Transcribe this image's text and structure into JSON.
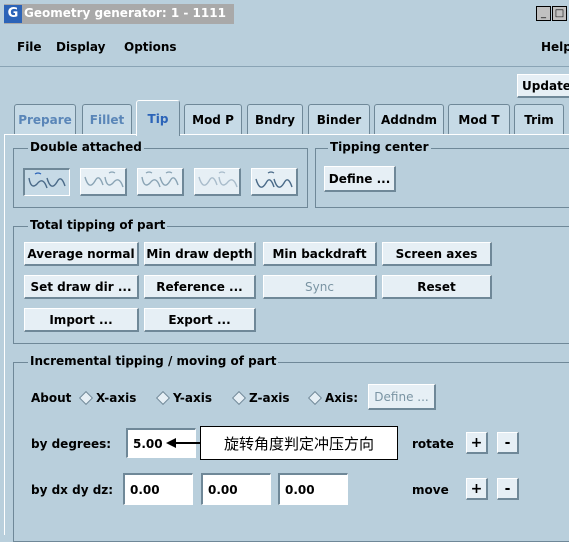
{
  "window": {
    "title": "Geometry generator: 1 - 1111",
    "app_icon": "G",
    "controls": [
      "_",
      "□",
      ""
    ]
  },
  "menu": {
    "file": "File",
    "display": "Display",
    "options": "Options",
    "help": "Help"
  },
  "toolbar": {
    "update": "Update"
  },
  "tabs": [
    {
      "label": "Prepare",
      "state": "disabled"
    },
    {
      "label": "Fillet",
      "state": "disabled"
    },
    {
      "label": "Tip",
      "state": "active"
    },
    {
      "label": "Mod P",
      "state": "normal"
    },
    {
      "label": "Bndry",
      "state": "normal"
    },
    {
      "label": "Binder",
      "state": "normal"
    },
    {
      "label": "Addndm",
      "state": "normal"
    },
    {
      "label": "Mod T",
      "state": "normal"
    },
    {
      "label": "Trim",
      "state": "normal"
    }
  ],
  "double_attached": {
    "label": "Double attached",
    "icons": [
      "double-attached-icon-1",
      "double-attached-icon-2",
      "double-attached-icon-3",
      "double-attached-icon-4",
      "double-attached-icon-5"
    ]
  },
  "tipping_center": {
    "label": "Tipping center",
    "define": "Define ..."
  },
  "total_tipping": {
    "label": "Total tipping of part",
    "average_normal": "Average normal",
    "min_draw_depth": "Min draw depth",
    "min_backdraft": "Min backdraft",
    "screen_axes": "Screen axes",
    "set_draw_dir": "Set draw dir ...",
    "reference": "Reference ...",
    "sync": "Sync",
    "reset": "Reset",
    "import": "Import ...",
    "export": "Export ..."
  },
  "incremental": {
    "label": "Incremental tipping / moving of part",
    "about": "About",
    "x_axis": "X-axis",
    "y_axis": "Y-axis",
    "z_axis": "Z-axis",
    "axis": "Axis:",
    "define": "Define ...",
    "by_degrees_label": "by degrees:",
    "degrees_value": "5.00",
    "annotation": "旋转角度判定冲压方向",
    "rotate": "rotate",
    "plus": "+",
    "minus": "-",
    "by_dxdydz_label": "by dx dy dz:",
    "dx": "0.00",
    "dy": "0.00",
    "dz": "0.00",
    "move": "move"
  },
  "colors": {
    "panel_bg": "#b9cfdc",
    "button_bg": "#e6eff5",
    "accent_blue": "#2b63b8",
    "disabled_text": "#7a94a3"
  }
}
